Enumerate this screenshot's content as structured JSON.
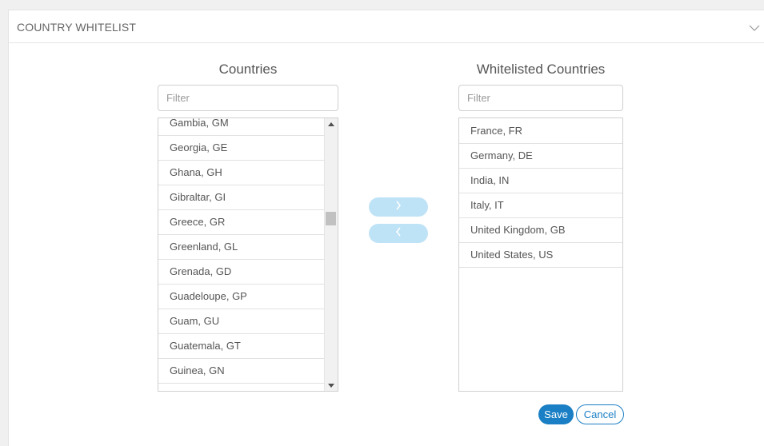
{
  "panel": {
    "title": "COUNTRY WHITELIST"
  },
  "countries": {
    "title": "Countries",
    "filter_placeholder": "Filter",
    "items": [
      "Gambia, GM",
      "Georgia, GE",
      "Ghana, GH",
      "Gibraltar, GI",
      "Greece, GR",
      "Greenland, GL",
      "Grenada, GD",
      "Guadeloupe, GP",
      "Guam, GU",
      "Guatemala, GT",
      "Guinea, GN"
    ]
  },
  "whitelisted": {
    "title": "Whitelisted Countries",
    "filter_placeholder": "Filter",
    "items": [
      "France, FR",
      "Germany, DE",
      "India, IN",
      "Italy, IT",
      "United Kingdom, GB",
      "United States, US"
    ]
  },
  "actions": {
    "save_label": "Save",
    "cancel_label": "Cancel"
  },
  "colors": {
    "accent": "#1a7fc4",
    "move_button": "#bfe3f6"
  }
}
